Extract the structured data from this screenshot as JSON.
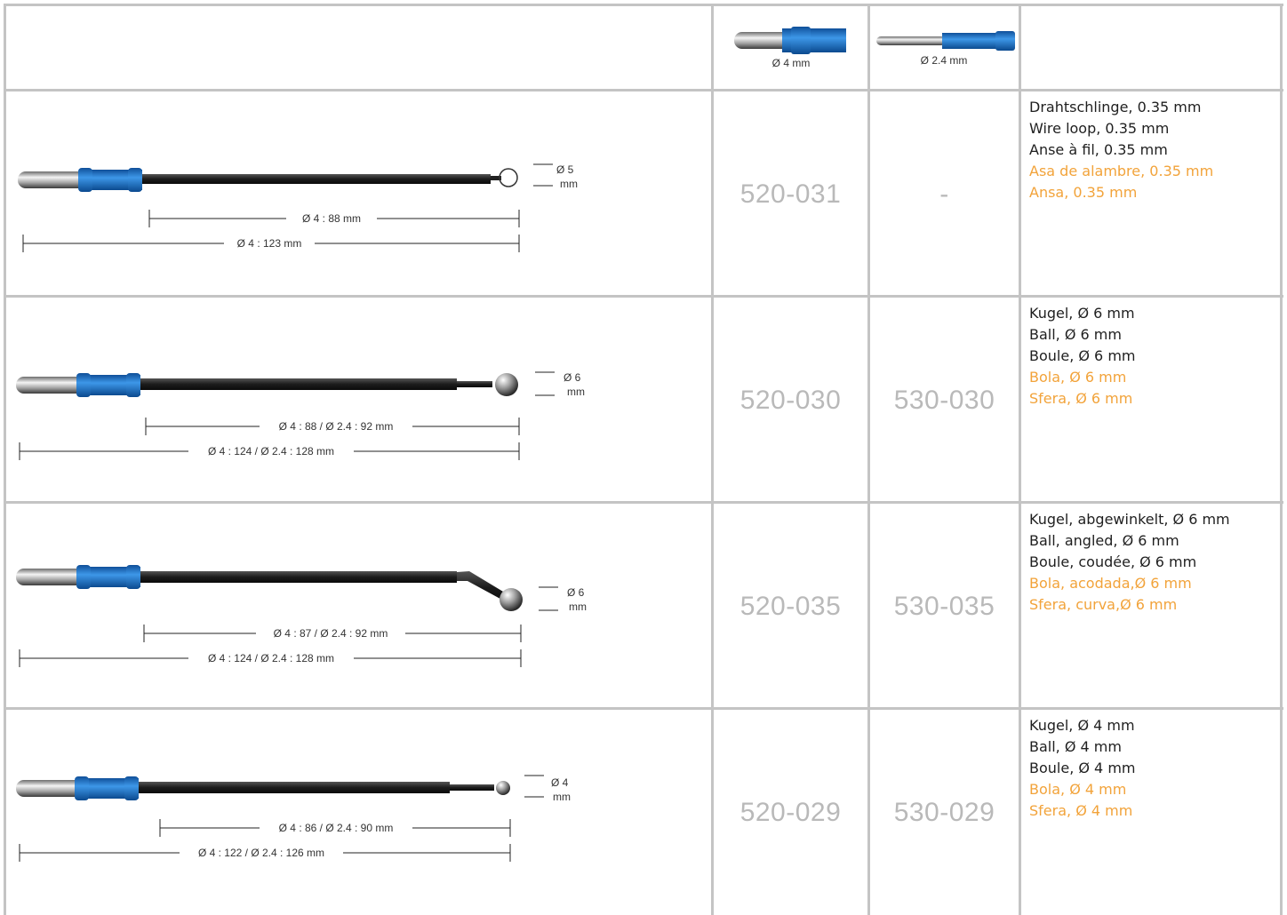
{
  "header": {
    "connector_4mm_label": "Ø 4 mm",
    "connector_24mm_label": "Ø 2.4 mm"
  },
  "rows": [
    {
      "tip_dim": [
        "Ø 5",
        "mm"
      ],
      "dim_short": "Ø 4 : 88 mm",
      "dim_long": "Ø 4 : 123 mm",
      "code_4mm": "520-031",
      "code_24mm": "-",
      "desc_de": "Drahtschlinge, 0.35 mm",
      "desc_en": "Wire loop, 0.35 mm",
      "desc_fr": "Anse à fil, 0.35 mm",
      "desc_es": "Asa de alambre, 0.35 mm",
      "desc_it": "Ansa, 0.35 mm"
    },
    {
      "tip_dim": [
        "Ø 6",
        "mm"
      ],
      "dim_short": "Ø 4 : 88 / Ø 2.4 : 92 mm",
      "dim_long": "Ø 4 : 124 / Ø 2.4 : 128 mm",
      "code_4mm": "520-030",
      "code_24mm": "530-030",
      "desc_de": "Kugel, Ø 6 mm",
      "desc_en": "Ball, Ø 6 mm",
      "desc_fr": "Boule, Ø 6 mm",
      "desc_es": "Bola, Ø 6 mm",
      "desc_it": "Sfera, Ø 6 mm"
    },
    {
      "tip_dim": [
        "Ø 6",
        "mm"
      ],
      "dim_short": "Ø 4 : 87 / Ø 2.4 : 92 mm",
      "dim_long": "Ø 4 : 124 / Ø 2.4 : 128 mm",
      "code_4mm": "520-035",
      "code_24mm": "530-035",
      "desc_de": "Kugel, abgewinkelt, Ø 6 mm",
      "desc_en": "Ball, angled, Ø 6 mm",
      "desc_fr": "Boule, coudée, Ø 6 mm",
      "desc_es": "Bola, acodada,Ø 6 mm",
      "desc_it": "Sfera, curva,Ø 6 mm"
    },
    {
      "tip_dim": [
        "Ø 4",
        "mm"
      ],
      "dim_short": "Ø 4 : 86 / Ø 2.4 : 90 mm",
      "dim_long": "Ø 4 : 122 / Ø 2.4 : 126 mm",
      "code_4mm": "520-029",
      "code_24mm": "530-029",
      "desc_de": "Kugel, Ø 4 mm",
      "desc_en": "Ball, Ø 4 mm",
      "desc_fr": "Boule, Ø 4 mm",
      "desc_es": "Bola, Ø 4 mm",
      "desc_it": "Sfera, Ø 4 mm"
    }
  ],
  "colors": {
    "grid": "#c4c4c4",
    "code": "#b9b9b9",
    "translation_accent": "#f2a33a",
    "connector_blue": "#1e73c8"
  }
}
